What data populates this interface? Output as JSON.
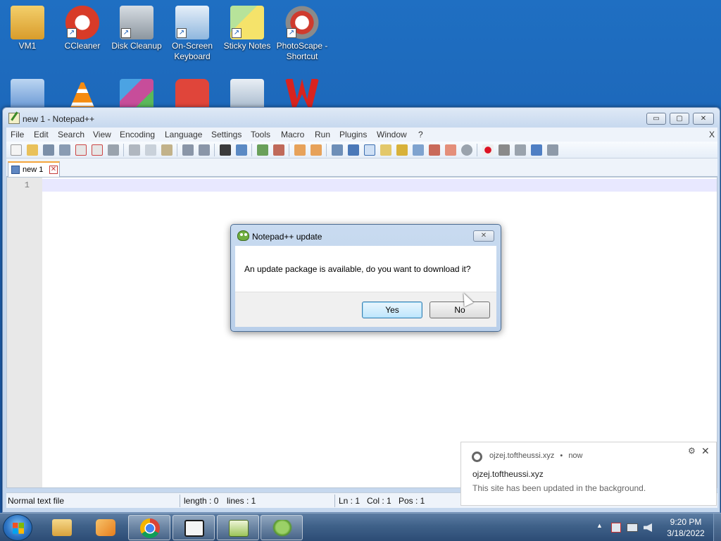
{
  "desktop": {
    "icons": [
      {
        "label": "VM1",
        "icon": "user-folder-icon",
        "color": "#e8b443"
      },
      {
        "label": "CCleaner",
        "icon": "ccleaner-icon",
        "color": "#d83b28"
      },
      {
        "label": "Disk Cleanup",
        "icon": "disk-cleanup-icon",
        "color": "#9aa4ad"
      },
      {
        "label": "On-Screen Keyboard",
        "icon": "keyboard-icon",
        "color": "#8fb7de"
      },
      {
        "label": "Sticky Notes",
        "icon": "sticky-notes-icon",
        "color": "#f5e36a"
      },
      {
        "label": "PhotoScape - Shortcut",
        "icon": "photoscape-icon",
        "color": "#cf3b2e"
      }
    ],
    "row2_icons": [
      {
        "icon": "computer-icon",
        "color": "#5d8fd0"
      },
      {
        "icon": "vlc-icon",
        "color": "#f58b10"
      },
      {
        "icon": "installer-icon",
        "color": "#c74d9a"
      },
      {
        "icon": "presentation-icon",
        "color": "#e0453a"
      },
      {
        "icon": "settings-app-icon",
        "color": "#9fb3c8"
      },
      {
        "icon": "wps-office-icon",
        "color": "#d8231f"
      }
    ]
  },
  "window": {
    "title": "new 1 - Notepad++",
    "controls": {
      "minimize": "▭",
      "maximize": "▢",
      "close": "✕"
    }
  },
  "menu": {
    "items": [
      "File",
      "Edit",
      "Search",
      "View",
      "Encoding",
      "Language",
      "Settings",
      "Tools",
      "Macro",
      "Run",
      "Plugins",
      "Window",
      "?"
    ],
    "close_doc": "X"
  },
  "tabs": [
    {
      "label": "new 1",
      "close": "✕"
    }
  ],
  "editor": {
    "line_numbers": [
      "1"
    ]
  },
  "statusbar": {
    "file_type": "Normal text file",
    "length": "length : 0",
    "lines": "lines : 1",
    "ln": "Ln : 1",
    "col": "Col : 1",
    "pos": "Pos : 1"
  },
  "dialog": {
    "title": "Notepad++ update",
    "close": "✕",
    "message": "An update package is available, do you want to download it?",
    "yes_label": "Yes",
    "no_label": "No"
  },
  "toast": {
    "origin": "ojzej.toftheussi.xyz",
    "separator": "•",
    "time": "now",
    "gear": "⚙",
    "close": "✕",
    "title": "ojzej.toftheussi.xyz",
    "body": "This site has been updated in the background."
  },
  "taskbar": {
    "apps": [
      {
        "icon": "file-explorer-icon",
        "color": "#e3b552",
        "active": false
      },
      {
        "icon": "media-player-icon",
        "color": "#f29a2e",
        "active": false
      },
      {
        "icon": "chrome-icon",
        "color": "#db4437",
        "active": true
      },
      {
        "icon": "7zip-icon",
        "color": "#1b1b1b",
        "active": true
      },
      {
        "icon": "notepad-editor-icon",
        "color": "#7cb342",
        "active": true
      },
      {
        "icon": "notepadpp-icon",
        "color": "#6fae3f",
        "active": true
      }
    ],
    "tray": {
      "show_hidden": "▲",
      "time": "9:20 PM",
      "date": "3/18/2022"
    }
  },
  "colors": {
    "desktop_background": "#1b62b4",
    "window_frame": "#c6d8ee",
    "current_line": "#e8e8ff",
    "yes_button_focus": "#3c7fb1"
  }
}
